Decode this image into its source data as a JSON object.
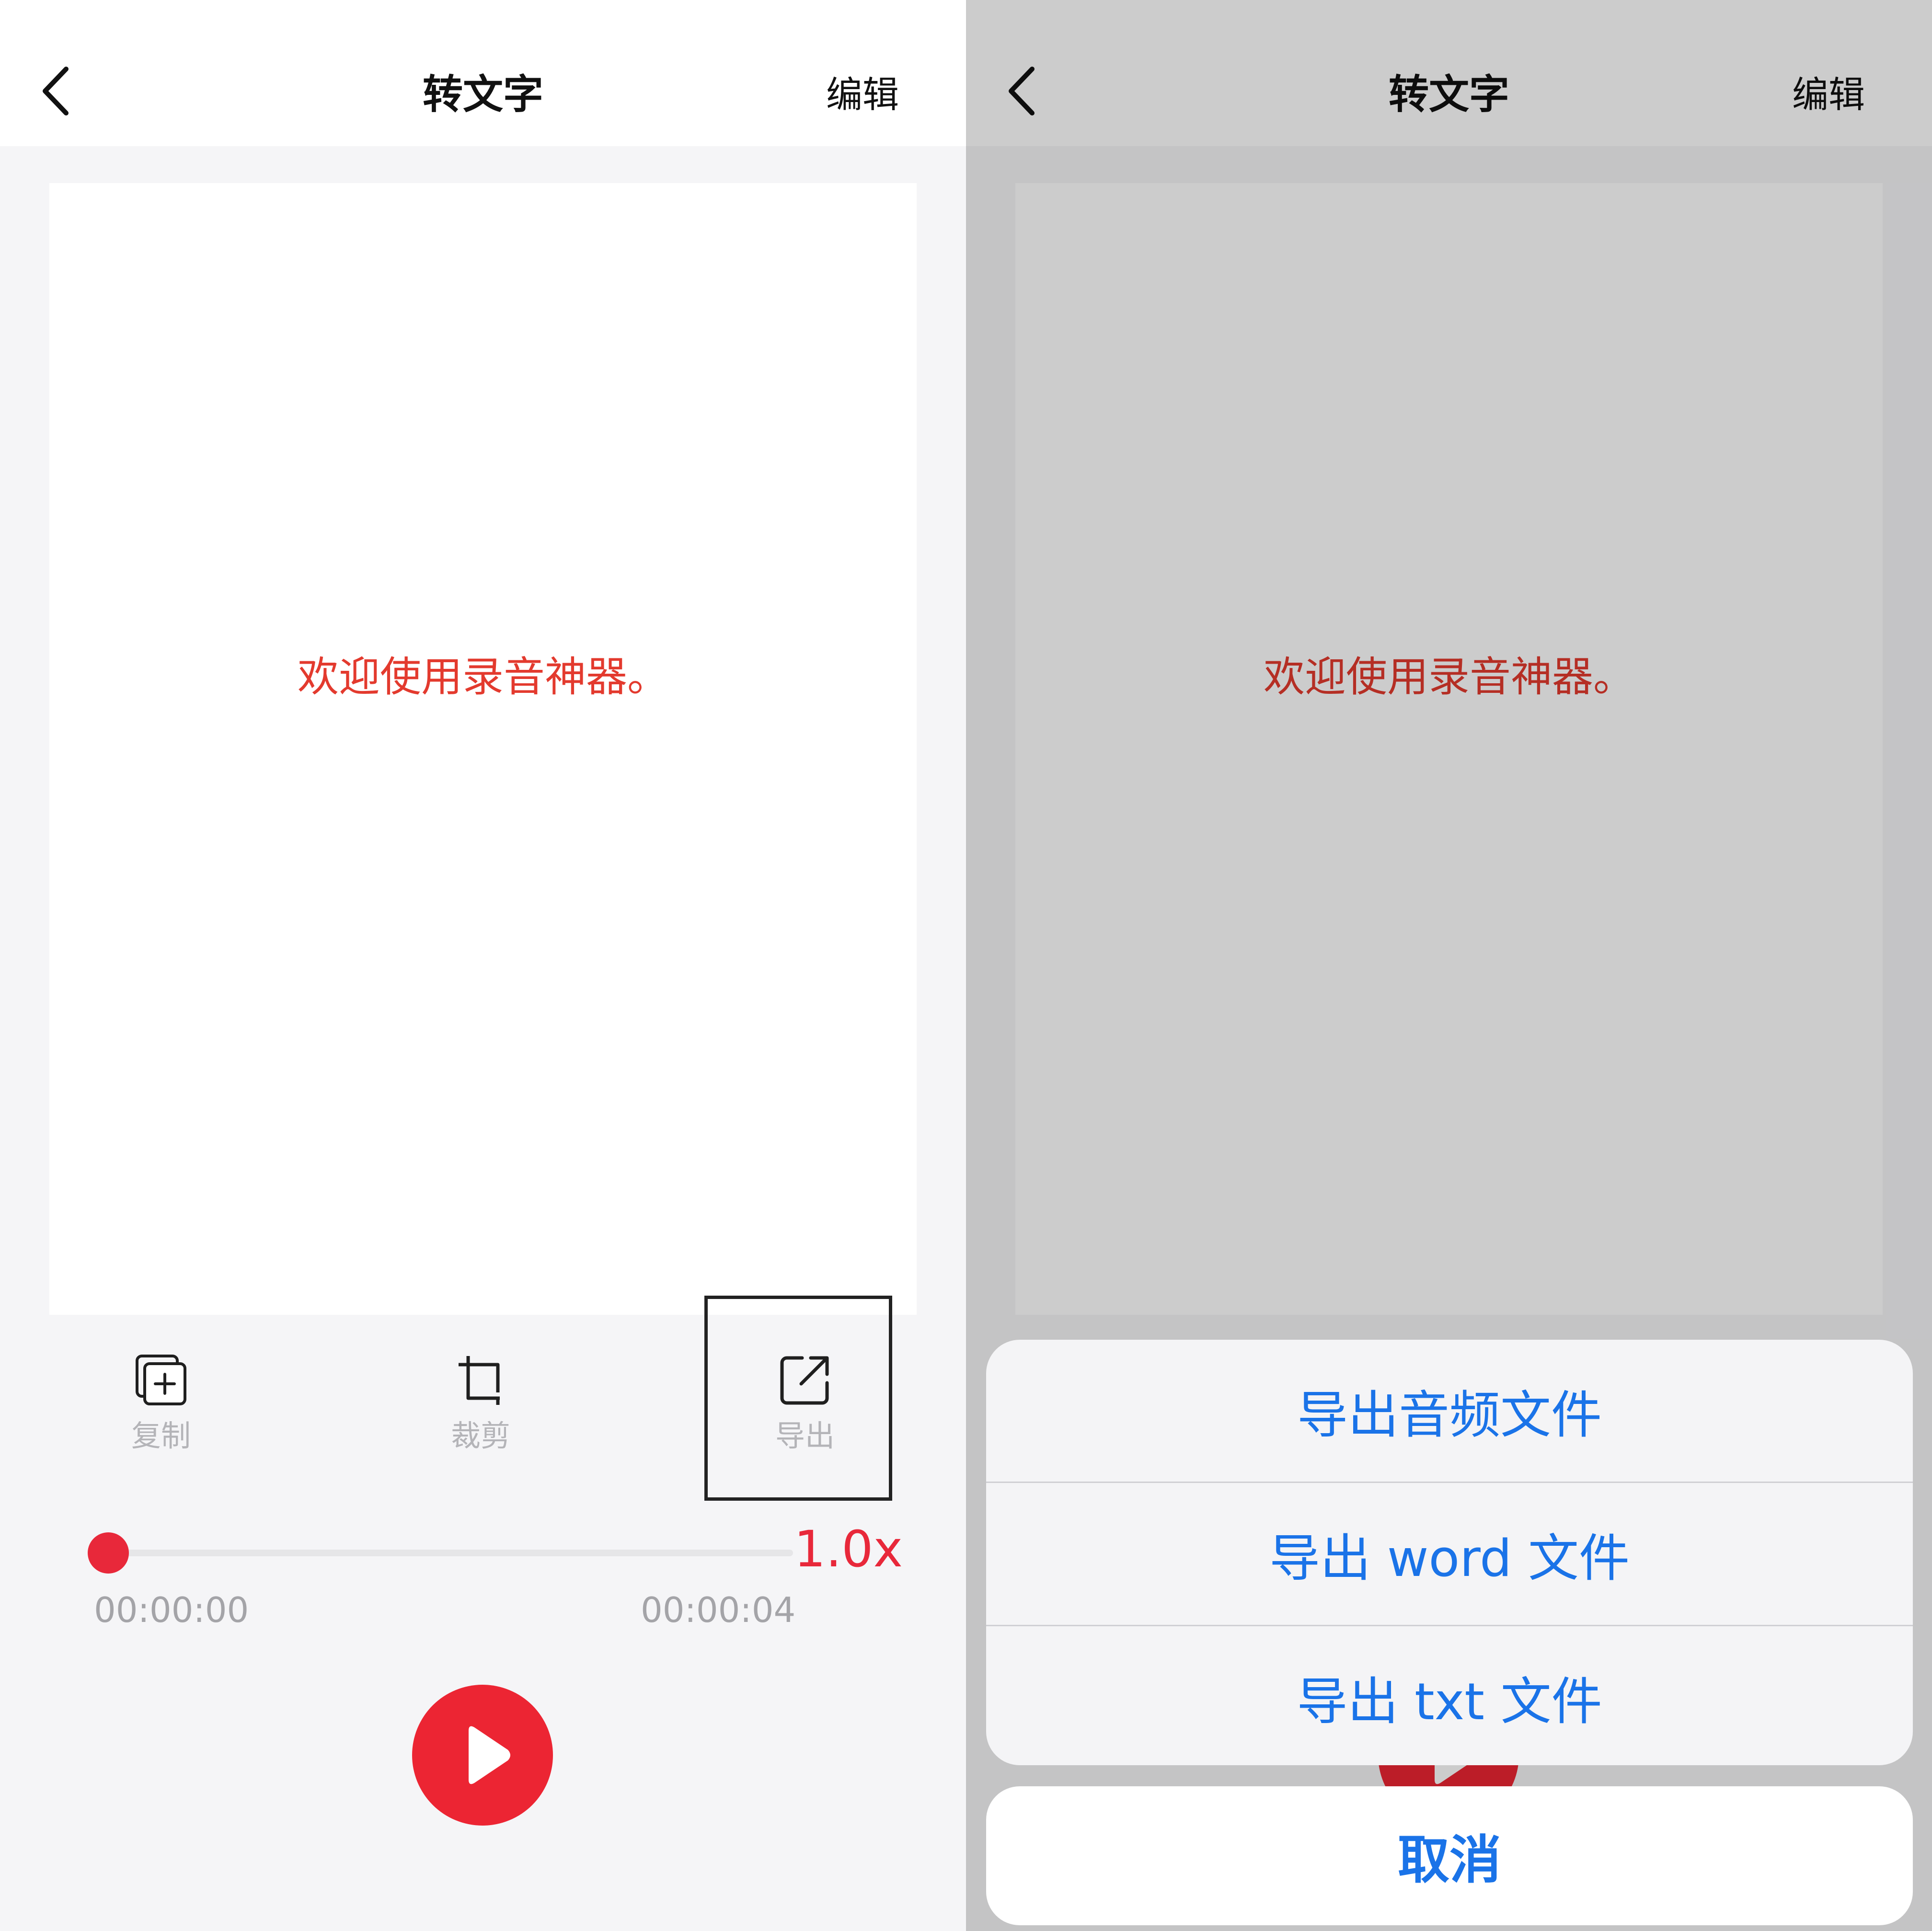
{
  "nav": {
    "title": "转文字",
    "edit_label": "编辑"
  },
  "transcript": {
    "text": "欢迎使用录音神器。"
  },
  "toolbar": {
    "copy_label": "复制",
    "crop_label": "裁剪",
    "export_label": "导出"
  },
  "player": {
    "speed": "1.0x",
    "current_time": "00:00:00",
    "total_time": "00:00:04",
    "progress": 0
  },
  "export_sheet": {
    "options": [
      "导出音频文件",
      "导出 word 文件",
      "导出 txt 文件"
    ],
    "cancel_label": "取消"
  },
  "colors": {
    "accent_red": "#e8283a",
    "text_red": "#e33a2e",
    "action_blue": "#1a73e8",
    "muted_gray": "#b4b4b8"
  },
  "icons": [
    "back-icon",
    "copy-icon",
    "crop-icon",
    "export-icon",
    "play-icon"
  ]
}
